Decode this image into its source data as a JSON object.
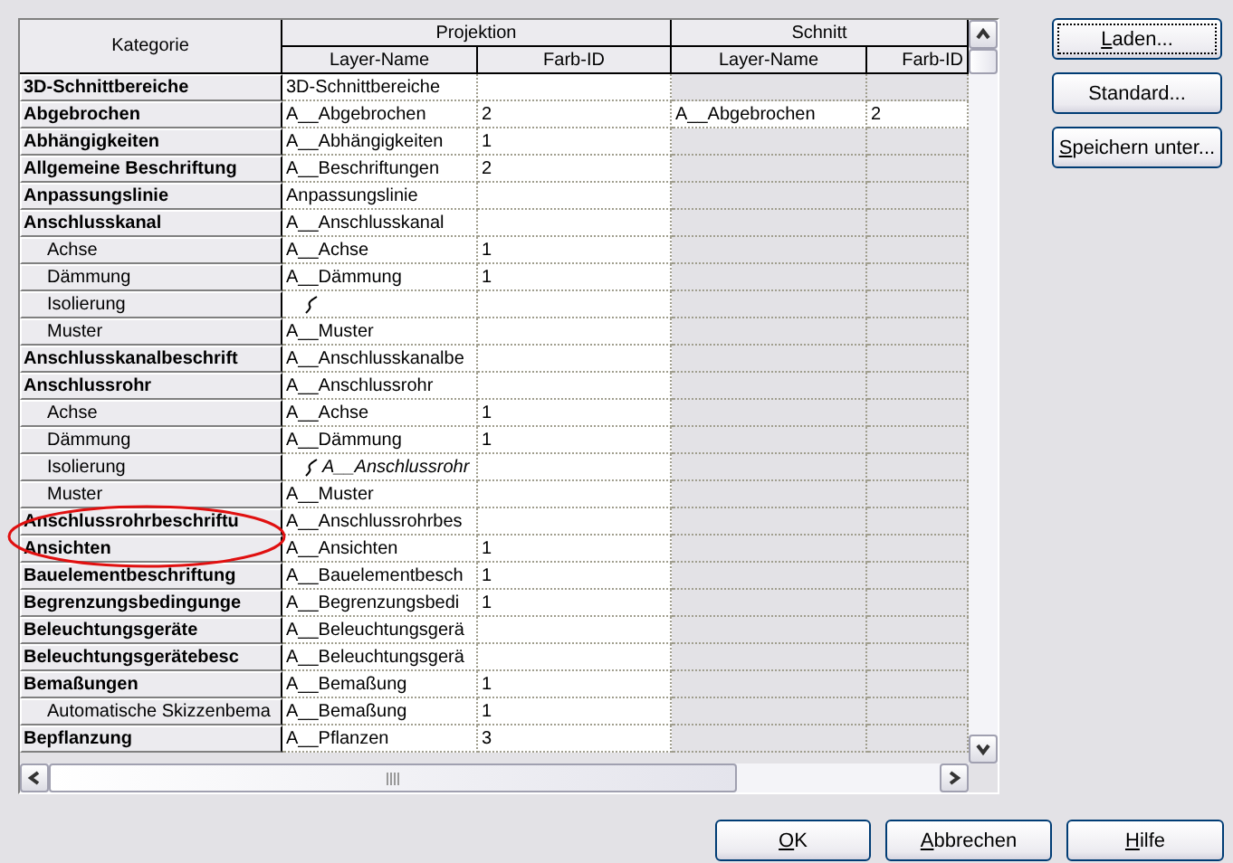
{
  "table": {
    "columns": {
      "category": "Kategorie",
      "projection": "Projektion",
      "section": "Schnitt",
      "projection_layer": "Layer-Name",
      "projection_id": "Farb-ID",
      "section_layer": "Layer-Name",
      "section_id": "Farb-ID"
    },
    "rows": [
      {
        "kind": "category",
        "name": "3D-Schnittbereiche",
        "layer": "3D-Schnittbereiche",
        "section_editable": false
      },
      {
        "kind": "category",
        "name": "Abgebrochen",
        "layer": "A__Abgebrochen",
        "id": "2",
        "section_editable": true,
        "section_layer": "A__Abgebrochen",
        "section_id": "2"
      },
      {
        "kind": "category",
        "name": "Abhängigkeiten",
        "layer": "A__Abhängigkeiten",
        "id": "1",
        "section_editable": false
      },
      {
        "kind": "category",
        "name": "Allgemeine Beschriftung",
        "layer": "A__Beschriftungen",
        "id": "2",
        "section_editable": false
      },
      {
        "kind": "category",
        "name": "Anpassungslinie",
        "layer": "Anpassungslinie",
        "section_editable": false
      },
      {
        "kind": "category",
        "name": "Anschlusskanal",
        "layer": "A__Anschlusskanal",
        "section_editable": false
      },
      {
        "kind": "sub",
        "name": "Achse",
        "layer": "A__Achse",
        "id": "1",
        "section_editable": false
      },
      {
        "kind": "sub",
        "name": "Dämmung",
        "layer": "A__Dämmung",
        "id": "1",
        "section_editable": false
      },
      {
        "kind": "sub",
        "name": "Isolierung",
        "linestyle_icon": true,
        "section_editable": false
      },
      {
        "kind": "sub",
        "name": "Muster",
        "layer": "A__Muster",
        "section_editable": false
      },
      {
        "kind": "category",
        "name": "Anschlusskanalbeschrift",
        "layer": "A__Anschlusskanalbe",
        "section_editable": false
      },
      {
        "kind": "category",
        "name": "Anschlussrohr",
        "layer": "A__Anschlussrohr",
        "section_editable": false
      },
      {
        "kind": "sub",
        "name": "Achse",
        "layer": "A__Achse",
        "id": "1",
        "section_editable": false
      },
      {
        "kind": "sub",
        "name": "Dämmung",
        "layer": "A__Dämmung",
        "id": "1",
        "section_editable": false
      },
      {
        "kind": "sub",
        "name": "Isolierung",
        "linestyle_icon": true,
        "layer": "A__Anschlussrohr",
        "section_editable": false
      },
      {
        "kind": "sub",
        "name": "Muster",
        "layer": "A__Muster",
        "section_editable": false
      },
      {
        "kind": "category",
        "name": "Anschlussrohrbeschriftu",
        "layer": "A__Anschlussrohrbes",
        "section_editable": false
      },
      {
        "kind": "category",
        "name": "Ansichten",
        "layer": "A__Ansichten",
        "id": "1",
        "section_editable": false
      },
      {
        "kind": "category",
        "name": "Bauelementbeschriftung",
        "layer": "A__Bauelementbesch",
        "id": "1",
        "section_editable": false
      },
      {
        "kind": "category",
        "name": "Begrenzungsbedingunge",
        "layer": "A__Begrenzungsbedi",
        "id": "1",
        "section_editable": false
      },
      {
        "kind": "category",
        "name": "Beleuchtungsgeräte",
        "layer": "A__Beleuchtungsgerä",
        "section_editable": false
      },
      {
        "kind": "category",
        "name": "Beleuchtungsgerätebesc",
        "layer": "A__Beleuchtungsgerä",
        "section_editable": false
      },
      {
        "kind": "category",
        "name": "Bemaßungen",
        "layer": "A__Bemaßung",
        "id": "1",
        "section_editable": false
      },
      {
        "kind": "sub",
        "name": "Automatische Skizzenbema",
        "layer": "A__Bemaßung",
        "id": "1",
        "section_editable": false
      },
      {
        "kind": "category",
        "name": "Bepflanzung",
        "layer": "A__Pflanzen",
        "id": "3",
        "section_editable": false
      }
    ]
  },
  "side_buttons": [
    {
      "label": "Laden...",
      "underline_first": true,
      "focused": true
    },
    {
      "label": "Standard...",
      "underline_first": false,
      "focused": false
    },
    {
      "label": "Speichern unter...",
      "underline_first": true,
      "focused": false
    }
  ],
  "footer_buttons": [
    {
      "label": "OK",
      "underline_first": true
    },
    {
      "label": "Abbrechen",
      "underline_first": true
    },
    {
      "label": "Hilfe",
      "underline_first": true
    }
  ],
  "annotation": {
    "kind": "ellipse",
    "color": "#e01010"
  }
}
